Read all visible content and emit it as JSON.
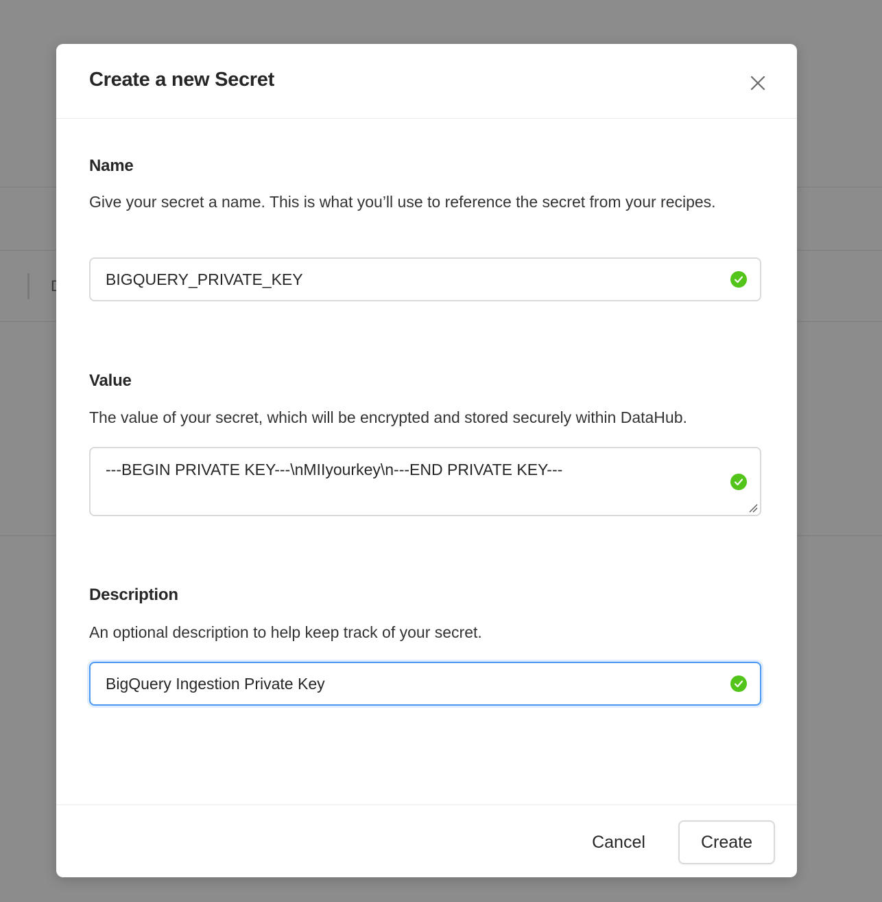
{
  "modal": {
    "title": "Create a new Secret",
    "close_label": "close"
  },
  "fields": {
    "name": {
      "label": "Name",
      "help": "Give your secret a name. This is what you’ll use to reference the secret from your recipes.",
      "value": "BIGQUERY_PRIVATE_KEY"
    },
    "value": {
      "label": "Value",
      "help": "The value of your secret, which will be encrypted and stored securely within DataHub.",
      "value": "---BEGIN PRIVATE KEY---\\nMIIyourkey\\n---END PRIVATE KEY---"
    },
    "description": {
      "label": "Description",
      "help": "An optional description to help keep track of your secret.",
      "value": "BigQuery Ingestion Private Key"
    }
  },
  "footer": {
    "cancel_label": "Cancel",
    "create_label": "Create"
  },
  "background": {
    "partial_char": "D"
  },
  "colors": {
    "success": "#52c41a",
    "focus_border": "#4a98f2",
    "overlay": "#8c8c8c"
  },
  "icons": {
    "close": "close-icon",
    "valid": "check-circle-icon",
    "resize": "resize-handle-icon"
  }
}
